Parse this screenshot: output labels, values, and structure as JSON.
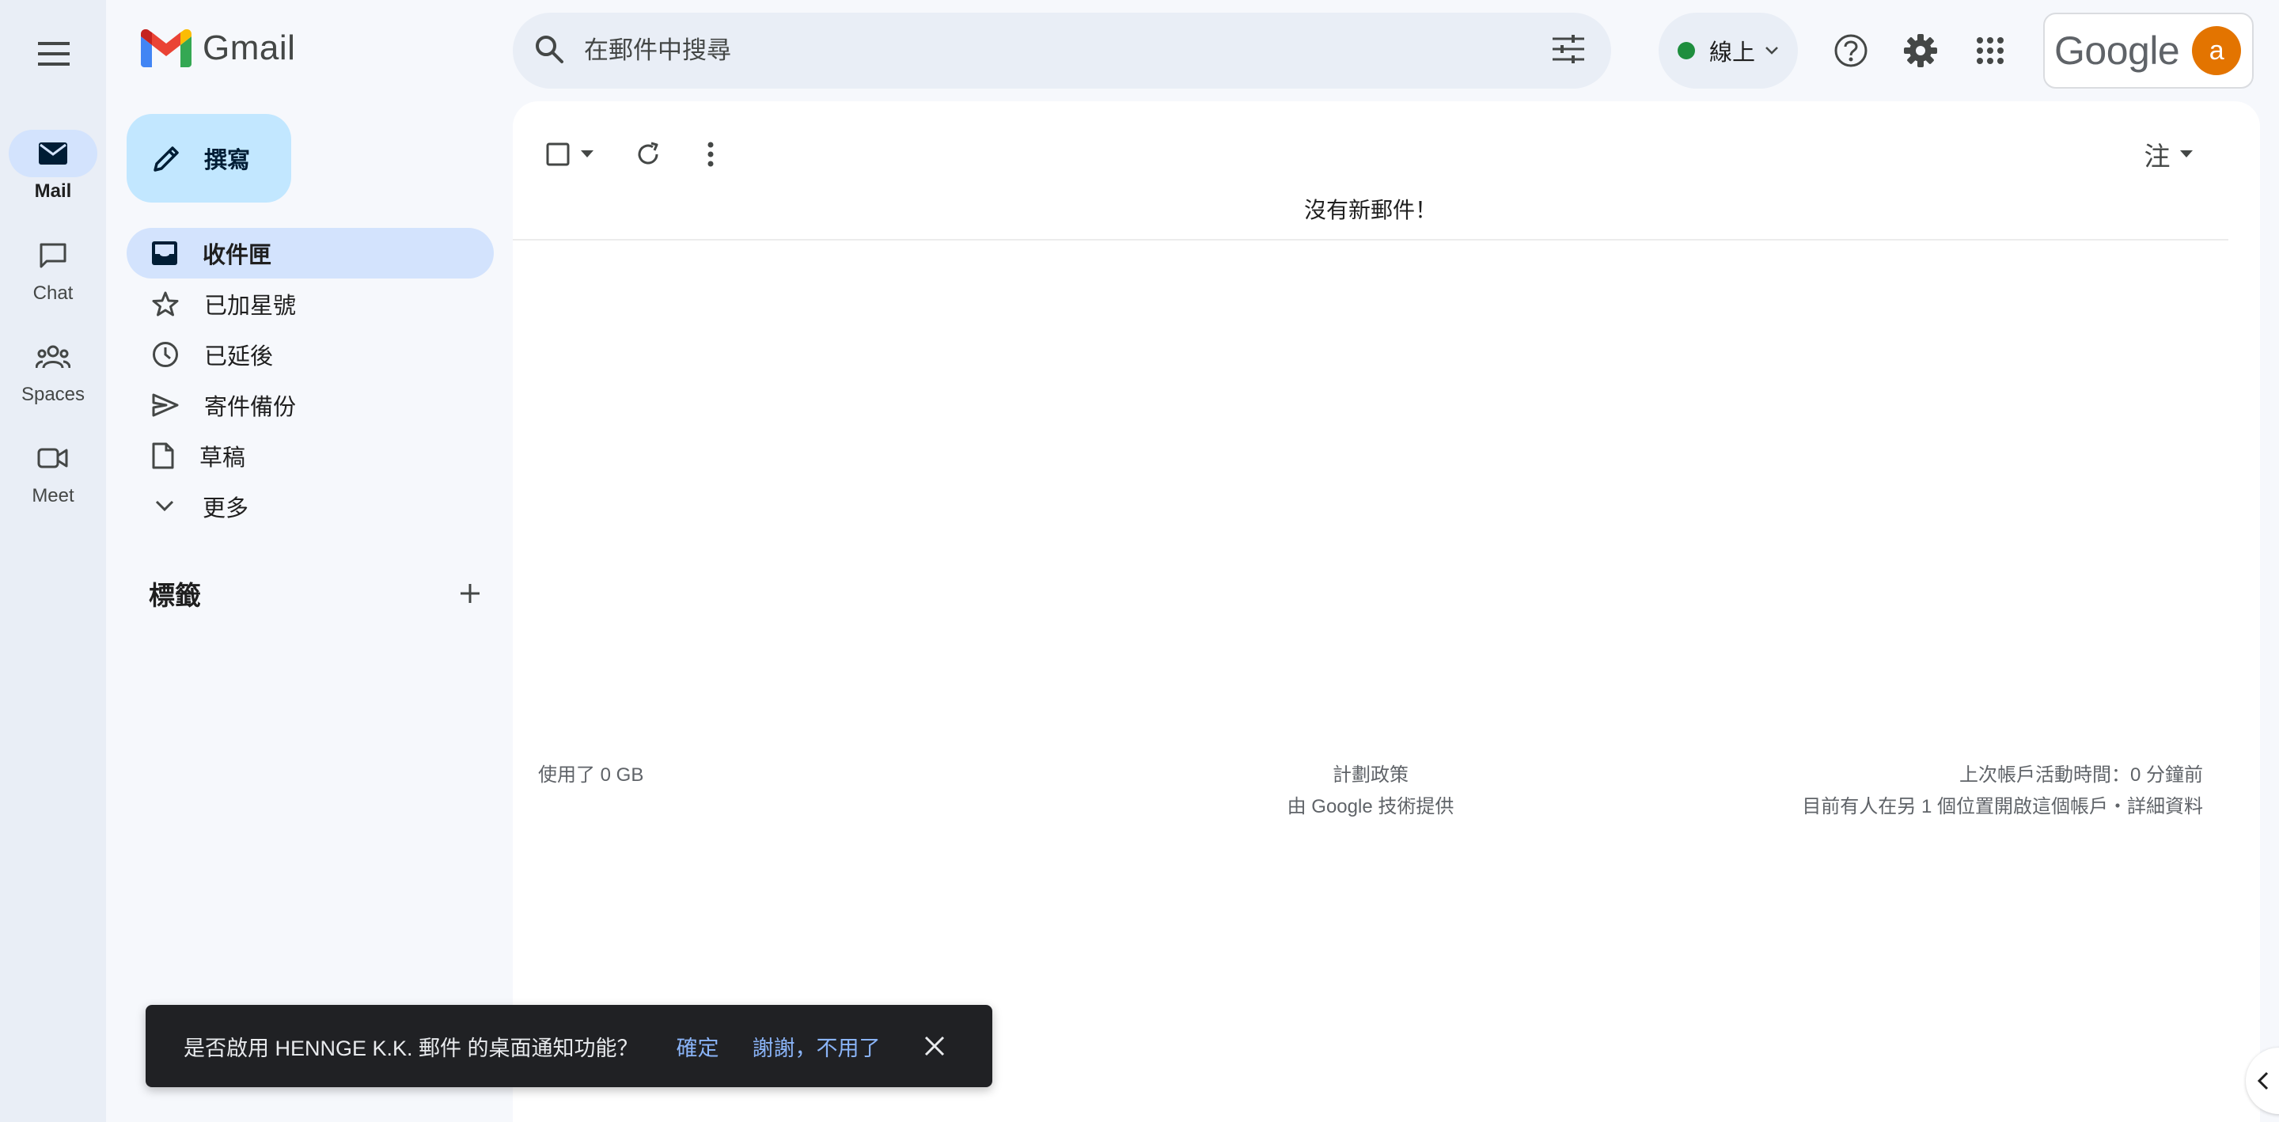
{
  "app": {
    "name": "Gmail",
    "google_brand": "Google"
  },
  "rail": {
    "items": [
      {
        "label": "Mail",
        "icon": "mail-icon",
        "active": true
      },
      {
        "label": "Chat",
        "icon": "chat-icon",
        "active": false
      },
      {
        "label": "Spaces",
        "icon": "spaces-icon",
        "active": false
      },
      {
        "label": "Meet",
        "icon": "meet-icon",
        "active": false
      }
    ]
  },
  "search": {
    "placeholder": "在郵件中搜尋"
  },
  "status": {
    "label": "線上",
    "color": "#1e8e3e"
  },
  "account": {
    "avatar_letter": "a",
    "avatar_color": "#e37400"
  },
  "compose": {
    "label": "撰寫"
  },
  "nav": {
    "items": [
      {
        "label": "收件匣",
        "icon": "inbox-icon",
        "active": true
      },
      {
        "label": "已加星號",
        "icon": "star-icon"
      },
      {
        "label": "已延後",
        "icon": "clock-icon"
      },
      {
        "label": "寄件備份",
        "icon": "send-icon"
      },
      {
        "label": "草稿",
        "icon": "draft-icon"
      },
      {
        "label": "更多",
        "icon": "chevron-down-icon"
      }
    ]
  },
  "labels": {
    "title": "標籤"
  },
  "toolbar": {
    "input_tool_label": "注"
  },
  "main": {
    "empty_message": "沒有新郵件！"
  },
  "footer": {
    "storage": "使用了 0 GB",
    "policy": "計劃政策",
    "powered_by": "由 Google 技術提供",
    "last_activity": "上次帳戶活動時間：0 分鐘前",
    "open_elsewhere": "目前有人在另 1 個位置開啟這個帳戶・詳細資料"
  },
  "snackbar": {
    "message": "是否啟用 HENNGE K.K. 郵件 的桌面通知功能？",
    "confirm": "確定",
    "dismiss": "謝謝，不用了"
  },
  "colors": {
    "accent": "#0b57d0",
    "compose_bg": "#c2e7ff",
    "nav_active_bg": "#d3e3fd",
    "snackbar_link": "#8ab4f8"
  }
}
